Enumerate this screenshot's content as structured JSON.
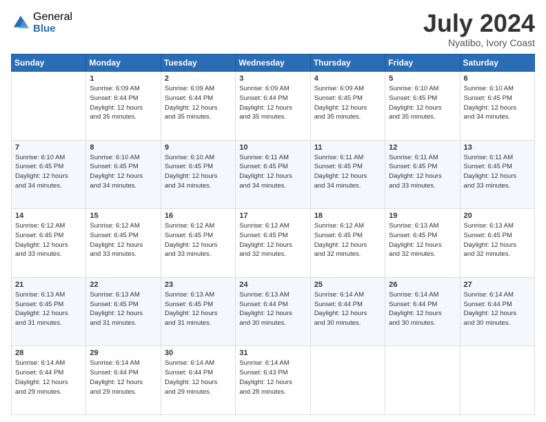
{
  "logo": {
    "general": "General",
    "blue": "Blue"
  },
  "title": {
    "month": "July 2024",
    "location": "Nyatibo, Ivory Coast"
  },
  "days_of_week": [
    "Sunday",
    "Monday",
    "Tuesday",
    "Wednesday",
    "Thursday",
    "Friday",
    "Saturday"
  ],
  "weeks": [
    [
      {
        "day": "",
        "sunrise": "",
        "sunset": "",
        "daylight": ""
      },
      {
        "day": "1",
        "sunrise": "6:09 AM",
        "sunset": "6:44 PM",
        "daylight": "12 hours and 35 minutes."
      },
      {
        "day": "2",
        "sunrise": "6:09 AM",
        "sunset": "6:44 PM",
        "daylight": "12 hours and 35 minutes."
      },
      {
        "day": "3",
        "sunrise": "6:09 AM",
        "sunset": "6:44 PM",
        "daylight": "12 hours and 35 minutes."
      },
      {
        "day": "4",
        "sunrise": "6:09 AM",
        "sunset": "6:45 PM",
        "daylight": "12 hours and 35 minutes."
      },
      {
        "day": "5",
        "sunrise": "6:10 AM",
        "sunset": "6:45 PM",
        "daylight": "12 hours and 35 minutes."
      },
      {
        "day": "6",
        "sunrise": "6:10 AM",
        "sunset": "6:45 PM",
        "daylight": "12 hours and 34 minutes."
      }
    ],
    [
      {
        "day": "7",
        "sunrise": "6:10 AM",
        "sunset": "6:45 PM",
        "daylight": "12 hours and 34 minutes."
      },
      {
        "day": "8",
        "sunrise": "6:10 AM",
        "sunset": "6:45 PM",
        "daylight": "12 hours and 34 minutes."
      },
      {
        "day": "9",
        "sunrise": "6:10 AM",
        "sunset": "6:45 PM",
        "daylight": "12 hours and 34 minutes."
      },
      {
        "day": "10",
        "sunrise": "6:11 AM",
        "sunset": "6:45 PM",
        "daylight": "12 hours and 34 minutes."
      },
      {
        "day": "11",
        "sunrise": "6:11 AM",
        "sunset": "6:45 PM",
        "daylight": "12 hours and 34 minutes."
      },
      {
        "day": "12",
        "sunrise": "6:11 AM",
        "sunset": "6:45 PM",
        "daylight": "12 hours and 33 minutes."
      },
      {
        "day": "13",
        "sunrise": "6:11 AM",
        "sunset": "6:45 PM",
        "daylight": "12 hours and 33 minutes."
      }
    ],
    [
      {
        "day": "14",
        "sunrise": "6:12 AM",
        "sunset": "6:45 PM",
        "daylight": "12 hours and 33 minutes."
      },
      {
        "day": "15",
        "sunrise": "6:12 AM",
        "sunset": "6:45 PM",
        "daylight": "12 hours and 33 minutes."
      },
      {
        "day": "16",
        "sunrise": "6:12 AM",
        "sunset": "6:45 PM",
        "daylight": "12 hours and 33 minutes."
      },
      {
        "day": "17",
        "sunrise": "6:12 AM",
        "sunset": "6:45 PM",
        "daylight": "12 hours and 32 minutes."
      },
      {
        "day": "18",
        "sunrise": "6:12 AM",
        "sunset": "6:45 PM",
        "daylight": "12 hours and 32 minutes."
      },
      {
        "day": "19",
        "sunrise": "6:13 AM",
        "sunset": "6:45 PM",
        "daylight": "12 hours and 32 minutes."
      },
      {
        "day": "20",
        "sunrise": "6:13 AM",
        "sunset": "6:45 PM",
        "daylight": "12 hours and 32 minutes."
      }
    ],
    [
      {
        "day": "21",
        "sunrise": "6:13 AM",
        "sunset": "6:45 PM",
        "daylight": "12 hours and 31 minutes."
      },
      {
        "day": "22",
        "sunrise": "6:13 AM",
        "sunset": "6:45 PM",
        "daylight": "12 hours and 31 minutes."
      },
      {
        "day": "23",
        "sunrise": "6:13 AM",
        "sunset": "6:45 PM",
        "daylight": "12 hours and 31 minutes."
      },
      {
        "day": "24",
        "sunrise": "6:13 AM",
        "sunset": "6:44 PM",
        "daylight": "12 hours and 30 minutes."
      },
      {
        "day": "25",
        "sunrise": "6:14 AM",
        "sunset": "6:44 PM",
        "daylight": "12 hours and 30 minutes."
      },
      {
        "day": "26",
        "sunrise": "6:14 AM",
        "sunset": "6:44 PM",
        "daylight": "12 hours and 30 minutes."
      },
      {
        "day": "27",
        "sunrise": "6:14 AM",
        "sunset": "6:44 PM",
        "daylight": "12 hours and 30 minutes."
      }
    ],
    [
      {
        "day": "28",
        "sunrise": "6:14 AM",
        "sunset": "6:44 PM",
        "daylight": "12 hours and 29 minutes."
      },
      {
        "day": "29",
        "sunrise": "6:14 AM",
        "sunset": "6:44 PM",
        "daylight": "12 hours and 29 minutes."
      },
      {
        "day": "30",
        "sunrise": "6:14 AM",
        "sunset": "6:44 PM",
        "daylight": "12 hours and 29 minutes."
      },
      {
        "day": "31",
        "sunrise": "6:14 AM",
        "sunset": "6:43 PM",
        "daylight": "12 hours and 28 minutes."
      },
      {
        "day": "",
        "sunrise": "",
        "sunset": "",
        "daylight": ""
      },
      {
        "day": "",
        "sunrise": "",
        "sunset": "",
        "daylight": ""
      },
      {
        "day": "",
        "sunrise": "",
        "sunset": "",
        "daylight": ""
      }
    ]
  ]
}
